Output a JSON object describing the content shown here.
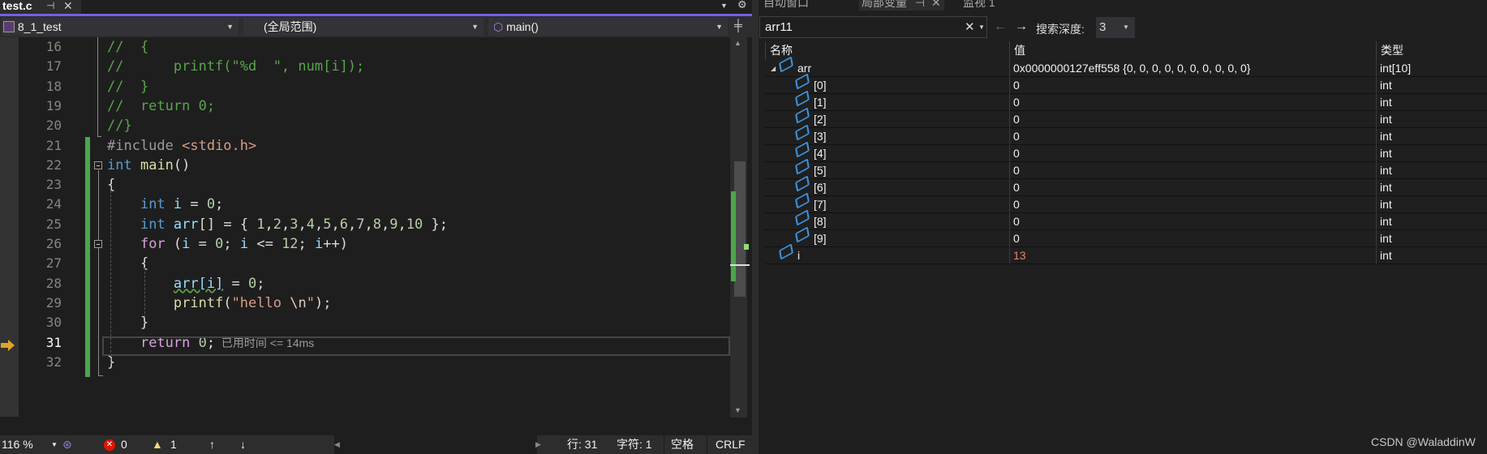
{
  "editor": {
    "tab": {
      "title": "test.c"
    },
    "navbar": {
      "project": "8_1_test",
      "scope": "(全局范围)",
      "member": "main()"
    },
    "lines": [
      {
        "n": "16",
        "tokens": [
          [
            "//  {",
            "comment"
          ]
        ]
      },
      {
        "n": "17",
        "tokens": [
          [
            "//      printf(\"%d  \", num[i]);",
            "comment"
          ]
        ]
      },
      {
        "n": "18",
        "tokens": [
          [
            "//  }",
            "comment"
          ]
        ]
      },
      {
        "n": "19",
        "tokens": [
          [
            "//  return 0;",
            "comment"
          ]
        ]
      },
      {
        "n": "20",
        "tokens": [
          [
            "//}",
            "comment"
          ]
        ]
      },
      {
        "n": "21",
        "tokens": [
          [
            "#include ",
            "pre"
          ],
          [
            "<stdio.h>",
            "str"
          ]
        ]
      },
      {
        "n": "22",
        "tokens": [
          [
            "int",
            "kw"
          ],
          [
            " ",
            "plain"
          ],
          [
            "main",
            "fn"
          ],
          [
            "()",
            "plain"
          ]
        ]
      },
      {
        "n": "23",
        "tokens": [
          [
            "{",
            "plain"
          ]
        ]
      },
      {
        "n": "24",
        "tokens": [
          [
            "    ",
            "plain"
          ],
          [
            "int",
            "kw"
          ],
          [
            " ",
            "plain"
          ],
          [
            "i",
            "var"
          ],
          [
            " = ",
            "plain"
          ],
          [
            "0",
            "num"
          ],
          [
            ";",
            "plain"
          ]
        ]
      },
      {
        "n": "25",
        "tokens": [
          [
            "    ",
            "plain"
          ],
          [
            "int",
            "kw"
          ],
          [
            " ",
            "plain"
          ],
          [
            "arr",
            "var"
          ],
          [
            "[] = { ",
            "plain"
          ],
          [
            "1",
            "num"
          ],
          [
            ",",
            "plain"
          ],
          [
            "2",
            "num"
          ],
          [
            ",",
            "plain"
          ],
          [
            "3",
            "num"
          ],
          [
            ",",
            "plain"
          ],
          [
            "4",
            "num"
          ],
          [
            ",",
            "plain"
          ],
          [
            "5",
            "num"
          ],
          [
            ",",
            "plain"
          ],
          [
            "6",
            "num"
          ],
          [
            ",",
            "plain"
          ],
          [
            "7",
            "num"
          ],
          [
            ",",
            "plain"
          ],
          [
            "8",
            "num"
          ],
          [
            ",",
            "plain"
          ],
          [
            "9",
            "num"
          ],
          [
            ",",
            "plain"
          ],
          [
            "10",
            "num"
          ],
          [
            " };",
            "plain"
          ]
        ]
      },
      {
        "n": "26",
        "tokens": [
          [
            "    ",
            "plain"
          ],
          [
            "for",
            "ctl"
          ],
          [
            " (",
            "plain"
          ],
          [
            "i",
            "var"
          ],
          [
            " = ",
            "plain"
          ],
          [
            "0",
            "num"
          ],
          [
            "; ",
            "plain"
          ],
          [
            "i",
            "var"
          ],
          [
            " <= ",
            "plain"
          ],
          [
            "12",
            "num"
          ],
          [
            "; ",
            "plain"
          ],
          [
            "i",
            "var"
          ],
          [
            "++)",
            "plain"
          ]
        ]
      },
      {
        "n": "27",
        "tokens": [
          [
            "    {",
            "plain"
          ]
        ]
      },
      {
        "n": "28",
        "tokens": [
          [
            "        ",
            "plain"
          ],
          [
            "arr[i]",
            "var squig"
          ],
          [
            " = ",
            "plain"
          ],
          [
            "0",
            "num"
          ],
          [
            ";",
            "plain"
          ]
        ]
      },
      {
        "n": "29",
        "tokens": [
          [
            "        ",
            "plain"
          ],
          [
            "printf",
            "fn"
          ],
          [
            "(",
            "plain"
          ],
          [
            "\"hello ",
            "str"
          ],
          [
            "\\n",
            "esc"
          ],
          [
            "\"",
            "str"
          ],
          [
            ");",
            "plain"
          ]
        ]
      },
      {
        "n": "30",
        "tokens": [
          [
            "    }",
            "plain"
          ]
        ]
      },
      {
        "n": "31",
        "tokens": [
          [
            "    ",
            "plain"
          ],
          [
            "return",
            "ctl"
          ],
          [
            " ",
            "plain"
          ],
          [
            "0",
            "num"
          ],
          [
            ";",
            "plain"
          ],
          [
            "  已用时间 <= 14ms",
            "hint"
          ]
        ],
        "current": true
      },
      {
        "n": "32",
        "tokens": [
          [
            "}",
            "plain"
          ]
        ]
      }
    ],
    "status": {
      "zoom": "116 %",
      "errors": "0",
      "warnings": "1",
      "line": "行: 31",
      "char": "字符: 1",
      "whitespace": "空格",
      "eol": "CRLF"
    }
  },
  "locals": {
    "tabs": [
      "自动窗口",
      "局部变量",
      "监视 1"
    ],
    "search_value": "arr11",
    "depth_label": "搜索深度:",
    "depth_value": "3",
    "columns": [
      "名称",
      "值",
      "类型"
    ],
    "rows": [
      {
        "name": "arr",
        "value": "0x0000000127eff558 {0, 0, 0, 0, 0, 0, 0, 0, 0, 0}",
        "type": "int[10]",
        "level": 0,
        "expanded": true
      },
      {
        "name": "[0]",
        "value": "0",
        "type": "int",
        "level": 1
      },
      {
        "name": "[1]",
        "value": "0",
        "type": "int",
        "level": 1
      },
      {
        "name": "[2]",
        "value": "0",
        "type": "int",
        "level": 1
      },
      {
        "name": "[3]",
        "value": "0",
        "type": "int",
        "level": 1
      },
      {
        "name": "[4]",
        "value": "0",
        "type": "int",
        "level": 1
      },
      {
        "name": "[5]",
        "value": "0",
        "type": "int",
        "level": 1
      },
      {
        "name": "[6]",
        "value": "0",
        "type": "int",
        "level": 1
      },
      {
        "name": "[7]",
        "value": "0",
        "type": "int",
        "level": 1
      },
      {
        "name": "[8]",
        "value": "0",
        "type": "int",
        "level": 1
      },
      {
        "name": "[9]",
        "value": "0",
        "type": "int",
        "level": 1
      },
      {
        "name": "i",
        "value": "13",
        "type": "int",
        "level": 0,
        "changed": true
      }
    ]
  },
  "watermark": "CSDN @WaladdinW",
  "colors": {
    "accent": "#7160e8",
    "changed_value": "#f0806a",
    "change_bar": "#4ca64c"
  }
}
